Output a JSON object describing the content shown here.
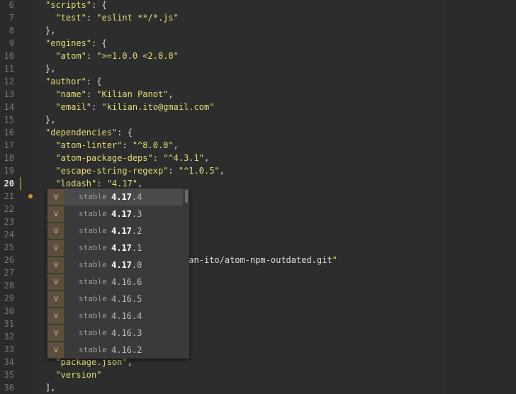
{
  "editor": {
    "lines": [
      {
        "num": "6",
        "text": "\"scripts\": {"
      },
      {
        "num": "7",
        "text": "  \"test\": \"eslint **/*.js\""
      },
      {
        "num": "8",
        "text": "},"
      },
      {
        "num": "9",
        "text": "\"engines\": {"
      },
      {
        "num": "10",
        "text": "  \"atom\": \">=1.0.0 <2.0.0\""
      },
      {
        "num": "11",
        "text": "},"
      },
      {
        "num": "12",
        "text": "\"author\": {"
      },
      {
        "num": "13",
        "text": "  \"name\": \"Kilian Panot\","
      },
      {
        "num": "14",
        "text": "  \"email\": \"kilian.ito@gmail.com\""
      },
      {
        "num": "15",
        "text": "},"
      },
      {
        "num": "16",
        "text": "\"dependencies\": {"
      },
      {
        "num": "17",
        "text": "  \"atom-linter\": \"^8.0.0\","
      },
      {
        "num": "18",
        "text": "  \"atom-package-deps\": \"^4.3.1\","
      },
      {
        "num": "19",
        "text": "  \"escape-string-regexp\": \"^1.0.5\","
      },
      {
        "num": "20",
        "text": "  \"lodash\": \"4.17\","
      },
      {
        "num": "21",
        "text": ""
      },
      {
        "num": "22",
        "text": ""
      },
      {
        "num": "23",
        "text": "}"
      },
      {
        "num": "24",
        "text": "\""
      },
      {
        "num": "25",
        "text": ""
      },
      {
        "num": "26",
        "text": "                       /kilian-ito/atom-npm-outdated.git\""
      },
      {
        "num": "27",
        "text": "}"
      },
      {
        "num": "28",
        "text": "\""
      },
      {
        "num": "29",
        "text": ""
      },
      {
        "num": "30",
        "text": ""
      },
      {
        "num": "31",
        "text": ""
      },
      {
        "num": "32",
        "text": ""
      },
      {
        "num": "33",
        "text": ""
      },
      {
        "num": "34",
        "text": "  \"package.json\","
      },
      {
        "num": "35",
        "text": "  \"version\""
      },
      {
        "num": "36",
        "text": "],"
      }
    ],
    "current_line": "20",
    "marker_line": "21"
  },
  "autocomplete": {
    "type_icon": "v",
    "items": [
      {
        "label": "stable",
        "match": "4.17",
        "rest": ".4",
        "selected": true
      },
      {
        "label": "stable",
        "match": "4.17",
        "rest": ".3"
      },
      {
        "label": "stable",
        "match": "4.17",
        "rest": ".2"
      },
      {
        "label": "stable",
        "match": "4.17",
        "rest": ".1"
      },
      {
        "label": "stable",
        "match": "4.17",
        "rest": ".0"
      },
      {
        "label": "stable",
        "match": "",
        "rest": "4.16.6"
      },
      {
        "label": "stable",
        "match": "",
        "rest": "4.16.5"
      },
      {
        "label": "stable",
        "match": "",
        "rest": "4.16.4"
      },
      {
        "label": "stable",
        "match": "",
        "rest": "4.16.3"
      },
      {
        "label": "stable",
        "match": "",
        "rest": "4.16.2"
      }
    ]
  }
}
